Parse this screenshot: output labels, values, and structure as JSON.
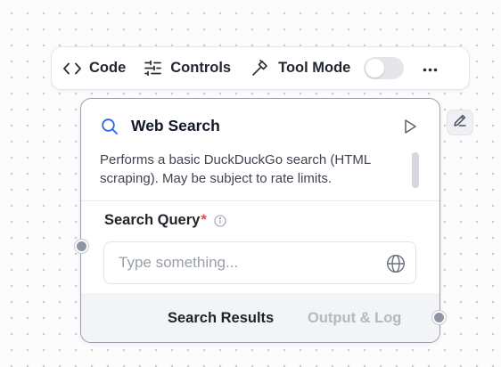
{
  "toolbar": {
    "code_label": "Code",
    "controls_label": "Controls",
    "tool_mode_label": "Tool Mode",
    "tool_mode_enabled": false,
    "code_icon": "code-icon",
    "controls_icon": "sliders-icon",
    "tool_mode_icon": "hammer-icon",
    "more_icon": "more-horizontal-icon"
  },
  "node": {
    "title": "Web Search",
    "icon": "search-icon",
    "description": "Performs a basic DuckDuckGo search (HTML scraping). May be subject to rate limits.",
    "field": {
      "label": "Search Query",
      "required_marker": "*",
      "placeholder": "Type something...",
      "value": "",
      "suffix_icon": "globe-icon"
    },
    "footer_tabs": [
      "Search Results",
      "Output & Log"
    ],
    "active_tab": "Search Results"
  },
  "colors": {
    "accent_blue": "#2563eb",
    "required_red": "#e5484d",
    "node_border": "#9aa1ad",
    "handle": "#8f96a3"
  }
}
